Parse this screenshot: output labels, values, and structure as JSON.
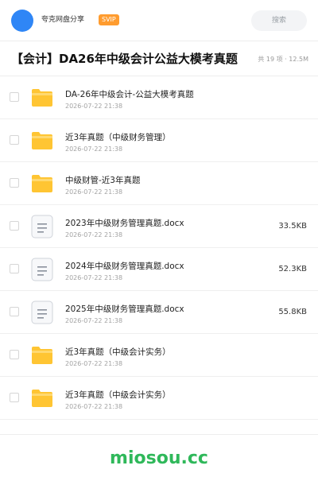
{
  "header": {
    "title": "夸克网盘分享",
    "badge": "SVIP",
    "search_placeholder": "搜索"
  },
  "folder": {
    "title": "【会计】DA26年中级会计公益大模考真题",
    "meta": "共 19 项 · 12.5M"
  },
  "files": [
    {
      "name": "DA-26年中级会计-公益大模考真题",
      "date": "2026-07-22 21:38",
      "size": "",
      "icon": "folder-icon"
    },
    {
      "name": "近3年真题（中级财务管理）",
      "date": "2026-07-22 21:38",
      "size": "",
      "icon": "folder-icon"
    },
    {
      "name": "中级财管-近3年真题",
      "date": "2026-07-22 21:38",
      "size": "",
      "icon": "folder-icon"
    },
    {
      "name": "2023年中级财务管理真题.docx",
      "date": "2026-07-22 21:38",
      "size": "33.5KB",
      "icon": "document-icon"
    },
    {
      "name": "2024年中级财务管理真题.docx",
      "date": "2026-07-22 21:38",
      "size": "52.3KB",
      "icon": "document-icon"
    },
    {
      "name": "2025年中级财务管理真题.docx",
      "date": "2026-07-22 21:38",
      "size": "55.8KB",
      "icon": "document-icon"
    },
    {
      "name": "近3年真题（中级会计实务）",
      "date": "2026-07-22 21:38",
      "size": "",
      "icon": "folder-icon"
    },
    {
      "name": "近3年真题（中级会计实务）",
      "date": "2026-07-22 21:38",
      "size": "",
      "icon": "folder-icon"
    }
  ],
  "watermark": "miosou.cc",
  "colors": {
    "avatar": "#2f86f6",
    "badge": "#ff9c2f",
    "folder": "#ffc533",
    "watermark": "#2fb85a"
  }
}
